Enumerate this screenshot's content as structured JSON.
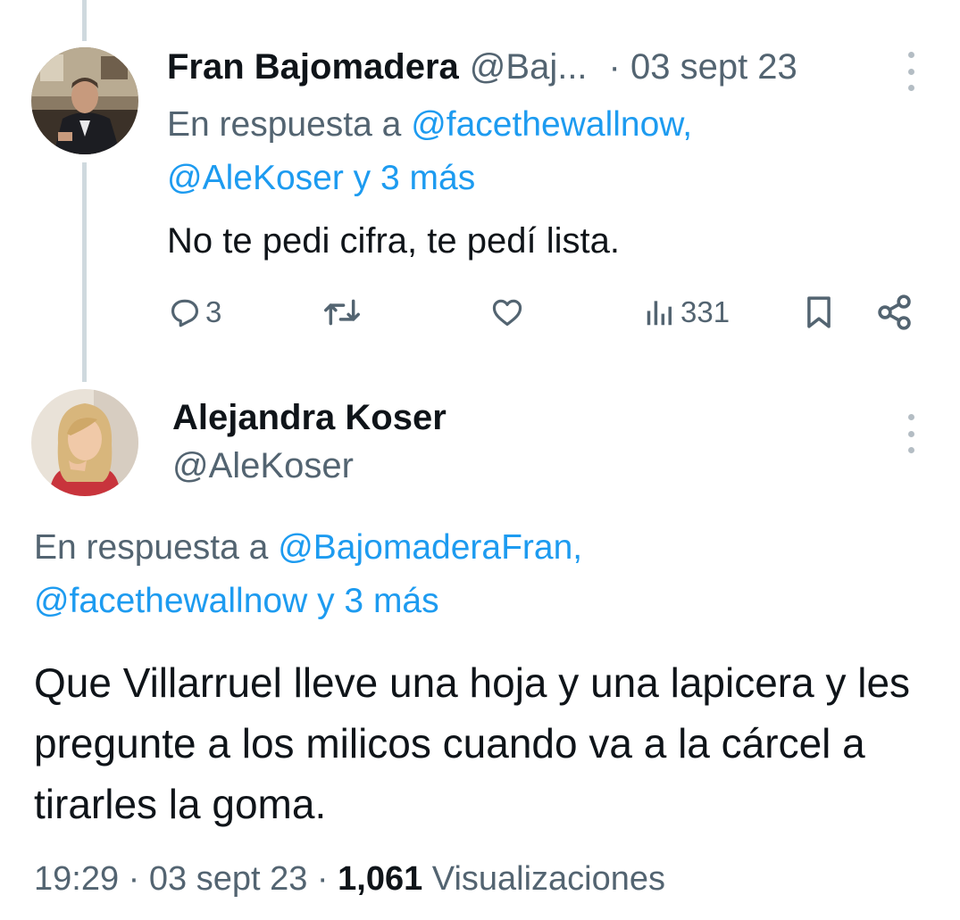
{
  "reply_tweet": {
    "author_name": "Fran Bajomadera",
    "author_handle": "@Baj...",
    "date": "· 03 sept 23",
    "context_prefix": "En respuesta a",
    "context_mention_1": "@facethewallnow,",
    "context_mention_2": "@AleKoser y 3 más",
    "text": "No te pedi cifra, te pedí lista.",
    "replies_count": "3",
    "views_count": "331"
  },
  "main_tweet": {
    "author_name": "Alejandra Koser",
    "author_handle": "@AleKoser",
    "context_prefix": "En respuesta a",
    "context_mention_1": "@BajomaderaFran,",
    "context_mention_2": "@facethewallnow y 3 más",
    "text": "Que Villarruel lleve una hoja y una lapicera y les pregunte a los milicos cuando va a la cárcel a tirarles la goma.",
    "time": "19:29",
    "date": "· 03 sept 23 ·",
    "views_count": "1,061",
    "views_label": "Visualizaciones"
  },
  "colors": {
    "text_primary": "#0f1419",
    "text_secondary": "#536471",
    "link": "#1d9bf0",
    "thread_line": "#cfd9de"
  },
  "icons": [
    "more-icon",
    "reply-icon",
    "retweet-icon",
    "like-icon",
    "views-icon",
    "bookmark-icon",
    "share-icon"
  ]
}
